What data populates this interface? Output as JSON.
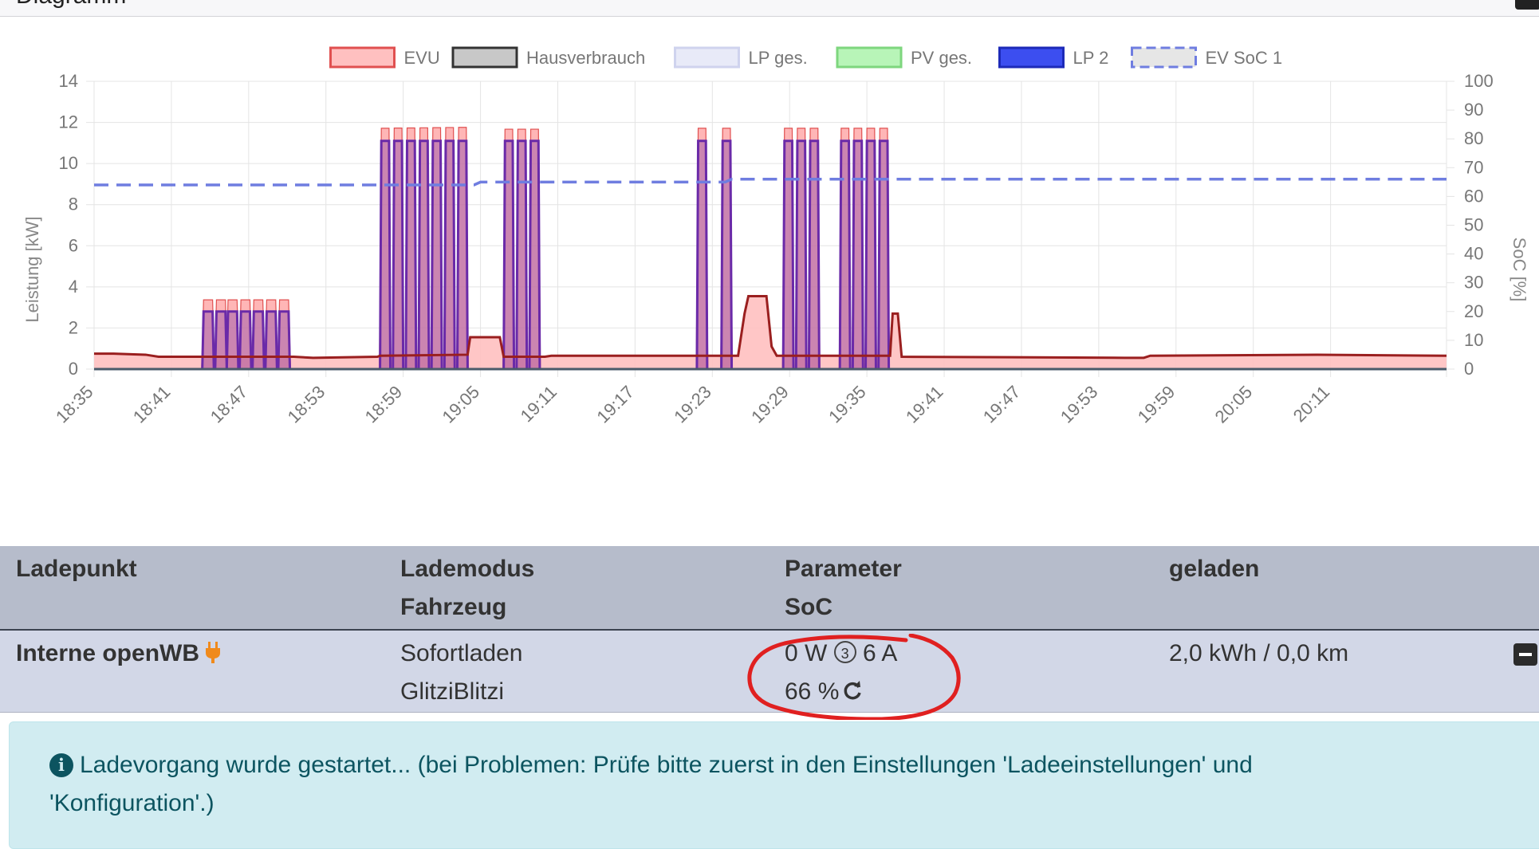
{
  "panel": {
    "title": "Diagramm"
  },
  "chart_data": {
    "type": "area",
    "title": "",
    "xlabel": "",
    "ylabel": "Leistung [kW]",
    "y2label": "SoC [%]",
    "ylim": [
      0,
      14
    ],
    "y2lim": [
      0,
      100
    ],
    "y_ticks": [
      "0",
      "2",
      "4",
      "6",
      "8",
      "10",
      "12",
      "14"
    ],
    "y2_ticks": [
      "0",
      "10",
      "20",
      "30",
      "40",
      "50",
      "60",
      "70",
      "80",
      "90",
      "100"
    ],
    "x_range_min": [
      0,
      105
    ],
    "x_ticks": [
      "18:35",
      "18:41",
      "18:47",
      "18:53",
      "18:59",
      "19:05",
      "19:11",
      "19:17",
      "19:23",
      "19:29",
      "19:35",
      "19:41",
      "19:47",
      "19:53",
      "19:59",
      "20:05",
      "20:11"
    ],
    "grid": true,
    "legend_position": "top",
    "legend": [
      {
        "name": "EVU",
        "fill": "#ffc0c0",
        "stroke": "#e05050",
        "dashed": false
      },
      {
        "name": "Hausverbrauch",
        "fill": "#c8c8c8",
        "stroke": "#333333",
        "dashed": false
      },
      {
        "name": "LP ges.",
        "fill": "#e8eaf8",
        "stroke": "#cfd3ee",
        "dashed": false
      },
      {
        "name": "PV ges.",
        "fill": "#b8f5b8",
        "stroke": "#7ed67e",
        "dashed": false
      },
      {
        "name": "LP 2",
        "fill": "#3c4ef0",
        "stroke": "#1d2ab8",
        "dashed": false
      },
      {
        "name": "EV SoC 1",
        "fill": "#e6e6e6",
        "stroke": "#6f7de0",
        "dashed": true
      }
    ],
    "series": [
      {
        "name": "LP 2",
        "unit": "kW",
        "pulses": [
          {
            "start": 8.5,
            "end": 9.2,
            "value": 2.8
          },
          {
            "start": 9.5,
            "end": 10.2,
            "value": 2.8
          },
          {
            "start": 10.4,
            "end": 11.1,
            "value": 2.8
          },
          {
            "start": 11.4,
            "end": 12.1,
            "value": 2.8
          },
          {
            "start": 12.4,
            "end": 13.1,
            "value": 2.8
          },
          {
            "start": 13.4,
            "end": 14.1,
            "value": 2.8
          },
          {
            "start": 14.4,
            "end": 15.1,
            "value": 2.8
          },
          {
            "start": 22.3,
            "end": 22.9,
            "value": 11.1
          },
          {
            "start": 23.3,
            "end": 23.9,
            "value": 11.1
          },
          {
            "start": 24.3,
            "end": 24.9,
            "value": 11.1
          },
          {
            "start": 25.3,
            "end": 25.9,
            "value": 11.1
          },
          {
            "start": 26.3,
            "end": 26.9,
            "value": 11.1
          },
          {
            "start": 27.3,
            "end": 27.9,
            "value": 11.1
          },
          {
            "start": 28.3,
            "end": 28.9,
            "value": 11.1
          },
          {
            "start": 31.9,
            "end": 32.5,
            "value": 11.1
          },
          {
            "start": 32.9,
            "end": 33.5,
            "value": 11.1
          },
          {
            "start": 33.9,
            "end": 34.5,
            "value": 11.1
          },
          {
            "start": 46.9,
            "end": 47.5,
            "value": 11.1
          },
          {
            "start": 48.8,
            "end": 49.4,
            "value": 11.1
          },
          {
            "start": 53.6,
            "end": 54.2,
            "value": 11.1
          },
          {
            "start": 54.6,
            "end": 55.2,
            "value": 11.1
          },
          {
            "start": 55.6,
            "end": 56.2,
            "value": 11.1
          },
          {
            "start": 58.0,
            "end": 58.6,
            "value": 11.1
          },
          {
            "start": 59.0,
            "end": 59.6,
            "value": 11.1
          },
          {
            "start": 60.0,
            "end": 60.6,
            "value": 11.1
          },
          {
            "start": 61.0,
            "end": 61.6,
            "value": 11.1
          }
        ]
      },
      {
        "name": "Hausverbrauch",
        "unit": "kW",
        "points": [
          [
            0,
            0.75
          ],
          [
            1.5,
            0.75
          ],
          [
            4,
            0.7
          ],
          [
            5,
            0.6
          ],
          [
            8.3,
            0.6
          ],
          [
            15.5,
            0.6
          ],
          [
            17,
            0.55
          ],
          [
            22,
            0.6
          ],
          [
            22.2,
            0.65
          ],
          [
            29,
            0.7
          ],
          [
            29.2,
            1.55
          ],
          [
            31.5,
            1.55
          ],
          [
            31.8,
            0.6
          ],
          [
            35,
            0.6
          ],
          [
            35.5,
            0.65
          ],
          [
            50,
            0.65
          ],
          [
            50.5,
            2.7
          ],
          [
            50.8,
            3.55
          ],
          [
            52.2,
            3.55
          ],
          [
            52.6,
            1.1
          ],
          [
            53,
            0.65
          ],
          [
            61.8,
            0.65
          ],
          [
            62,
            2.7
          ],
          [
            62.4,
            2.7
          ],
          [
            62.7,
            0.6
          ],
          [
            80,
            0.55
          ],
          [
            81.5,
            0.55
          ],
          [
            82,
            0.65
          ],
          [
            95,
            0.7
          ],
          [
            105,
            0.65
          ]
        ]
      },
      {
        "name": "EV SoC 1",
        "unit": "%",
        "points": [
          [
            0,
            64
          ],
          [
            29.5,
            64
          ],
          [
            30,
            65
          ],
          [
            49,
            65
          ],
          [
            49.5,
            66
          ],
          [
            105,
            66
          ]
        ]
      }
    ]
  },
  "table": {
    "headers": {
      "col1": "Ladepunkt",
      "col2_line1": "Lademodus",
      "col2_line2": "Fahrzeug",
      "col3_line1": "Parameter",
      "col3_line2": "SoC",
      "col4": "geladen"
    },
    "row": {
      "ladepunkt": "Interne openWB",
      "lademodus": "Sofortladen",
      "fahrzeug": "GlitziBlitzi",
      "power": "0 W",
      "phases": "3",
      "current": "6 A",
      "soc": "66 %",
      "geladen": "2,0 kWh / 0,0 km"
    }
  },
  "alert": {
    "text": "Ladevorgang wurde gestartet... (bei Problemen: Prüfe bitte zuerst in den Einstellungen 'Ladeeinstellungen' und 'Konfiguration'.)"
  },
  "colors": {
    "evu": "#e05050",
    "lp2": "#6a2aa8",
    "soc": "#6f7de0",
    "table_header": "#b6bccb",
    "table_row": "#d2d7e7",
    "alert_bg": "#d1ecf1",
    "annotation": "#e02020"
  }
}
